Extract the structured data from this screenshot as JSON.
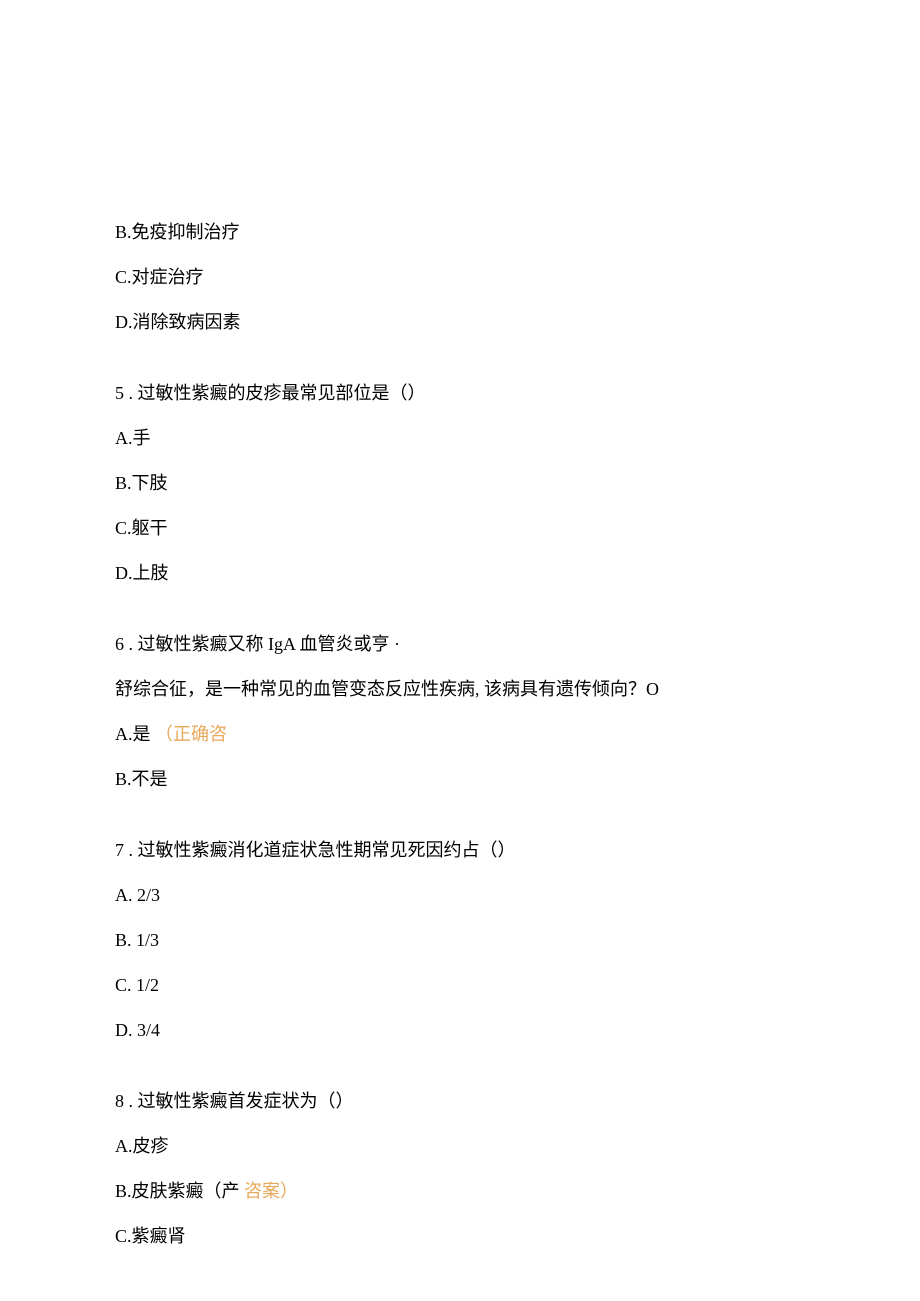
{
  "prelude": {
    "optionB": "B.免疫抑制治疗",
    "optionC": "C.对症治疗",
    "optionD": "D.消除致病因素"
  },
  "q5": {
    "number": "5",
    "text": ". 过敏性紫癜的皮疹最常见部位是（）",
    "optionA": "A.手",
    "optionB": "B.下肢",
    "optionC": "C.躯干",
    "optionD": "D.上肢"
  },
  "q6": {
    "number": "6",
    "text1": ". 过敏性紫癜又称 IgA 血管炎或亨 ·",
    "text2": "舒综合征，是一种常见的血管变态反应性疾病, 该病具有遗传倾向？O",
    "optionA_prefix": "A.是",
    "optionA_highlight": "（正确咨",
    "optionB": "B.不是"
  },
  "q7": {
    "number": "7",
    "text": ". 过敏性紫癜消化道症状急性期常见死因约占（）",
    "optionA": "A.   2/3",
    "optionB": "B.   1/3",
    "optionC": "C.   1/2",
    "optionD": "D.   3/4"
  },
  "q8": {
    "number": "8",
    "text": ". 过敏性紫癜首发症状为（）",
    "optionA": "A.皮疹",
    "optionB_prefix": "B.皮肤紫癜（产",
    "optionB_highlight": "咨案）",
    "optionC": "C.紫癜肾"
  }
}
